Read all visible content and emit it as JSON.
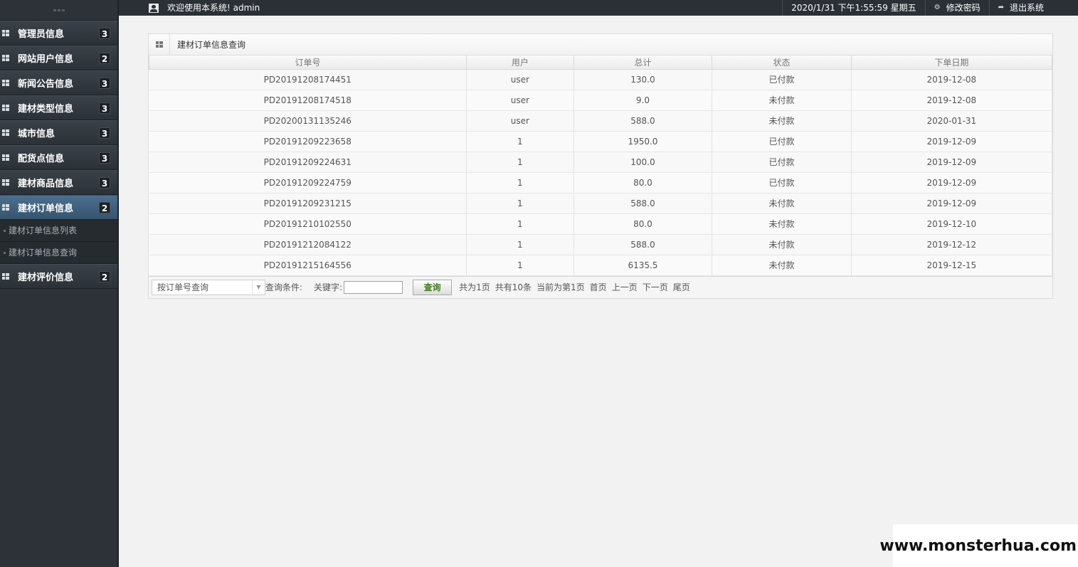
{
  "topbar": {
    "welcome": "欢迎使用本系统! admin",
    "datetime": "2020/1/31 下午1:55:59 星期五",
    "change_password": "修改密码",
    "logout": "退出系统"
  },
  "sidebar": {
    "items": [
      {
        "label": "管理员信息",
        "badge": "3"
      },
      {
        "label": "网站用户信息",
        "badge": "2"
      },
      {
        "label": "新闻公告信息",
        "badge": "3"
      },
      {
        "label": "建材类型信息",
        "badge": "3"
      },
      {
        "label": "城市信息",
        "badge": "3"
      },
      {
        "label": "配货点信息",
        "badge": "3"
      },
      {
        "label": "建材商品信息",
        "badge": "3"
      },
      {
        "label": "建材订单信息",
        "badge": "2"
      }
    ],
    "subitems": [
      "建材订单信息列表",
      "建材订单信息查询"
    ],
    "last_item": {
      "label": "建材评价信息",
      "badge": "2"
    }
  },
  "panel": {
    "title": "建材订单信息查询",
    "columns": [
      "订单号",
      "用户",
      "总计",
      "状态",
      "下单日期"
    ],
    "rows": [
      [
        "PD20191208174451",
        "user",
        "130.0",
        "已付款",
        "2019-12-08"
      ],
      [
        "PD20191208174518",
        "user",
        "9.0",
        "未付款",
        "2019-12-08"
      ],
      [
        "PD20200131135246",
        "user",
        "588.0",
        "未付款",
        "2020-01-31"
      ],
      [
        "PD20191209223658",
        "1",
        "1950.0",
        "已付款",
        "2019-12-09"
      ],
      [
        "PD20191209224631",
        "1",
        "100.0",
        "已付款",
        "2019-12-09"
      ],
      [
        "PD20191209224759",
        "1",
        "80.0",
        "已付款",
        "2019-12-09"
      ],
      [
        "PD20191209231215",
        "1",
        "588.0",
        "未付款",
        "2019-12-09"
      ],
      [
        "PD20191210102550",
        "1",
        "80.0",
        "未付款",
        "2019-12-10"
      ],
      [
        "PD20191212084122",
        "1",
        "588.0",
        "未付款",
        "2019-12-12"
      ],
      [
        "PD20191215164556",
        "1",
        "6135.5",
        "未付款",
        "2019-12-15"
      ]
    ]
  },
  "toolbar": {
    "select_value": "按订单号查询",
    "condition_label": "查询条件:",
    "keyword_label": "关键字:",
    "keyword_value": "",
    "query_button": "查询",
    "total_pages": "共为1页",
    "total_records": "共有10条",
    "current_page": "当前为第1页",
    "first": "首页",
    "prev": "上一页",
    "next": "下一页",
    "last": "尾页"
  },
  "watermark": "www.monsterhua.com"
}
